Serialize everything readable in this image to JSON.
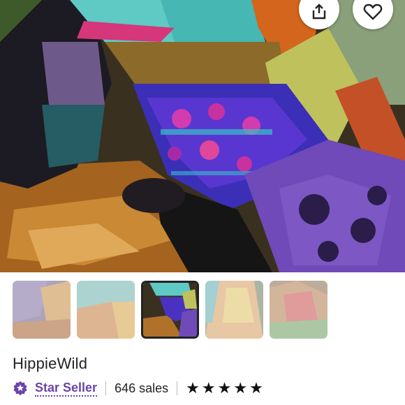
{
  "listing": {
    "hero_image_alt": "",
    "thumbnails": [
      {
        "id": "t1",
        "active": false
      },
      {
        "id": "t2",
        "active": false
      },
      {
        "id": "t3",
        "active": true
      },
      {
        "id": "t4",
        "active": false
      },
      {
        "id": "t5",
        "active": false
      }
    ]
  },
  "actions": {
    "share_icon": "share-icon",
    "favorite_icon": "heart-icon"
  },
  "shop": {
    "name": "HippieWild",
    "badge_label": "Star Seller",
    "sales": "646 sales",
    "rating_stars": 5,
    "rating_max": 5
  },
  "colors": {
    "star_seller": "#6b45a8",
    "text": "#222222"
  }
}
